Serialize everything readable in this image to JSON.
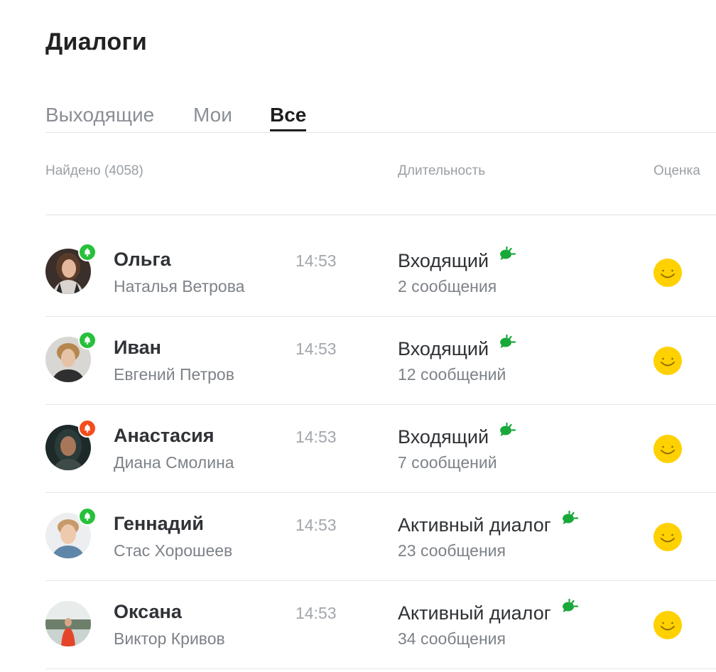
{
  "page": {
    "title": "Диалоги"
  },
  "tabs": [
    {
      "label": "Выходящие",
      "active": false
    },
    {
      "label": "Мои",
      "active": false
    },
    {
      "label": "Все",
      "active": true
    }
  ],
  "table": {
    "found_label": "Найдено (4058)",
    "duration_label": "Длительность",
    "rating_label": "Оценка"
  },
  "colors": {
    "notify_green": "#26c13a",
    "notify_red": "#f24d1c",
    "chat_icon": "#1aa83a",
    "smile": "#ffd100"
  },
  "rows": [
    {
      "name": "Ольга",
      "operator": "Наталья Ветрова",
      "time": "14:53",
      "status": "Входящий",
      "messages": "2 сообщения",
      "notify": "green",
      "icon": "bell-icon",
      "rating": "smile-icon"
    },
    {
      "name": "Иван",
      "operator": "Евгений Петров",
      "time": "14:53",
      "status": "Входящий",
      "messages": "12 сообщений",
      "notify": "green",
      "icon": "bell-icon",
      "rating": "smile-icon"
    },
    {
      "name": "Анастасия",
      "operator": "Диана Смолина",
      "time": "14:53",
      "status": "Входящий",
      "messages": "7 сообщений",
      "notify": "red",
      "icon": "bell-icon",
      "rating": "smile-icon"
    },
    {
      "name": "Геннадий",
      "operator": "Стас Хорошеев",
      "time": "14:53",
      "status": "Активный диалог",
      "messages": "23 сообщения",
      "notify": "green",
      "icon": "bell-icon",
      "rating": "smile-icon"
    },
    {
      "name": "Оксана",
      "operator": "Виктор Кривов",
      "time": "14:53",
      "status": "Активный диалог",
      "messages": "34 сообщения",
      "notify": "none",
      "icon": "bell-icon",
      "rating": "smile-icon"
    }
  ]
}
